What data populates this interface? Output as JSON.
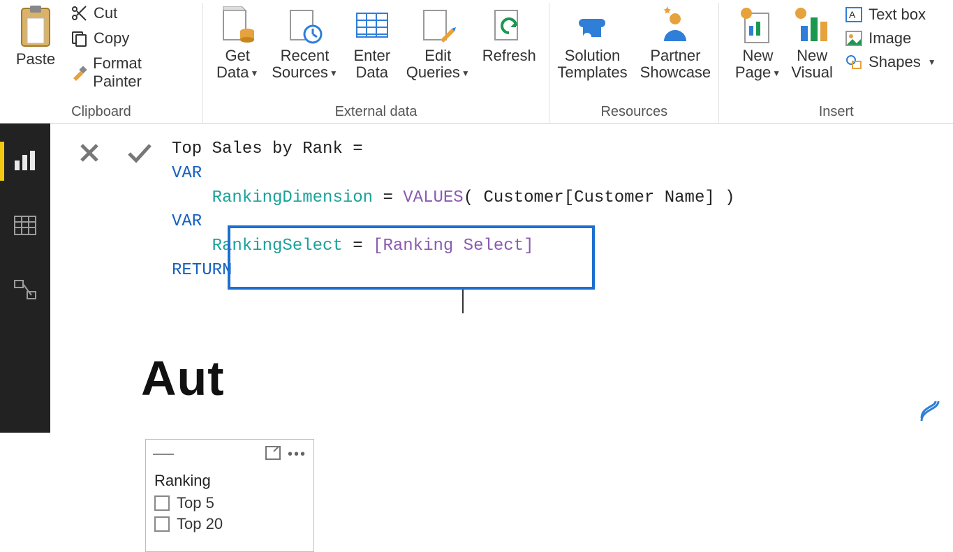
{
  "ribbon": {
    "groups": {
      "clipboard": {
        "label": "Clipboard",
        "paste": "Paste",
        "cut": "Cut",
        "copy": "Copy",
        "format_painter": "Format Painter"
      },
      "external_data": {
        "label": "External data",
        "get_data": "Get\nData",
        "recent_sources": "Recent\nSources",
        "enter_data": "Enter\nData",
        "edit_queries": "Edit\nQueries",
        "refresh": "Refresh"
      },
      "resources": {
        "label": "Resources",
        "solution_templates": "Solution\nTemplates",
        "partner_showcase": "Partner\nShowcase"
      },
      "insert": {
        "label": "Insert",
        "new_page": "New\nPage",
        "new_visual": "New\nVisual",
        "text_box": "Text box",
        "image": "Image",
        "shapes": "Shapes"
      }
    }
  },
  "formula": {
    "line1_plain": "Top Sales by Rank = ",
    "line2_kw": "VAR",
    "line3_indent": "    ",
    "line3_var": "RankingDimension",
    "line3_eq": " = ",
    "line3_fn": "VALUES",
    "line3_tail": "( Customer[Customer Name] )",
    "line4_kw": "VAR",
    "line5_indent": "    ",
    "line5_var": "RankingSelect",
    "line5_eq": " = ",
    "line5_ref": "[Ranking Select]",
    "line6_kw": "RETURN"
  },
  "canvas": {
    "title_partial": "Aut"
  },
  "slicer": {
    "title": "Ranking",
    "items": [
      "Top 5",
      "Top 20"
    ]
  },
  "icons": {
    "paste": "clipboard-paste-icon",
    "cut": "scissors-icon",
    "copy": "copy-icon",
    "format_painter": "brush-icon",
    "get_data": "page-cylinder-icon",
    "recent_sources": "page-clock-icon",
    "enter_data": "table-icon",
    "edit_queries": "page-pencil-icon",
    "refresh": "refresh-icon",
    "solution_templates": "puzzle-icon",
    "partner_showcase": "person-star-icon",
    "new_page": "page-sun-icon",
    "new_visual": "chart-sun-icon",
    "text_box": "textbox-icon",
    "image": "image-icon",
    "shapes": "shapes-icon"
  }
}
